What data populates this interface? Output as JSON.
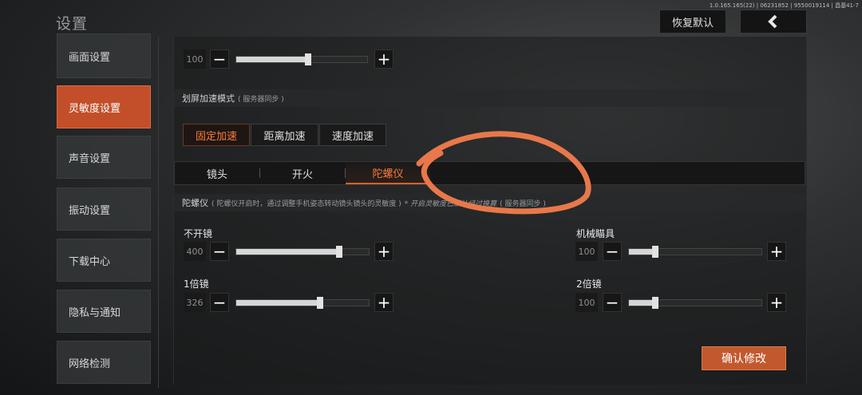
{
  "header": {
    "title": "设置",
    "version": "1.0.165.165(22) | 06231852 | 9550019114 | 昌基41-7",
    "restore_default": "恢复默认"
  },
  "sidebar": {
    "items": [
      {
        "label": "画面设置",
        "active": false
      },
      {
        "label": "灵敏度设置",
        "active": true
      },
      {
        "label": "声音设置",
        "active": false
      },
      {
        "label": "振动设置",
        "active": false
      },
      {
        "label": "下载中心",
        "active": false
      },
      {
        "label": "隐私与通知",
        "active": false
      },
      {
        "label": "网络检测",
        "active": false
      }
    ]
  },
  "top_slider": {
    "value": "100",
    "level": 0.55
  },
  "scroll_accel": {
    "title": "划屏加速模式",
    "note": "( 服务器同步 )",
    "modes": [
      "固定加速",
      "距离加速",
      "速度加速"
    ],
    "selected": "固定加速"
  },
  "tabs": {
    "items": [
      "镜头",
      "开火",
      "陀螺仪"
    ],
    "selected": "陀螺仪"
  },
  "gyro": {
    "title": "陀螺仪",
    "description": "( 陀螺仪开启时，通过调整手机姿态转动镜头镜头的灵敏度 )",
    "note": "* 开启灵敏度已默认经过换算",
    "sync": "( 服务器同步 )"
  },
  "sliders": [
    {
      "label": "不开镜",
      "value": "400",
      "level": 0.78
    },
    {
      "label": "机械瞄具",
      "value": "100",
      "level": 0.2
    },
    {
      "label": "1倍镜",
      "value": "326",
      "level": 0.63
    },
    {
      "label": "2倍镜",
      "value": "100",
      "level": 0.2
    }
  ],
  "confirm": "确认修改",
  "colors": {
    "accent": "#c24f2a",
    "active_text": "#ff7a3a",
    "annotation": "#e8784a"
  },
  "icons": {
    "back": "chevron-left-icon",
    "minus": "minus-icon",
    "plus": "plus-icon"
  }
}
